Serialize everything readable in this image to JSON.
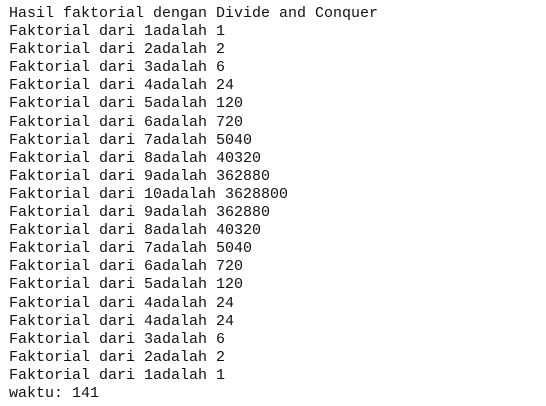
{
  "console": {
    "header": "Hasil faktorial dengan Divide and Conquer",
    "lines": [
      "Faktorial dari 1adalah 1",
      "Faktorial dari 2adalah 2",
      "Faktorial dari 3adalah 6",
      "Faktorial dari 4adalah 24",
      "Faktorial dari 5adalah 120",
      "Faktorial dari 6adalah 720",
      "Faktorial dari 7adalah 5040",
      "Faktorial dari 8adalah 40320",
      "Faktorial dari 9adalah 362880",
      "Faktorial dari 10adalah 3628800",
      "Faktorial dari 9adalah 362880",
      "Faktorial dari 8adalah 40320",
      "Faktorial dari 7adalah 5040",
      "Faktorial dari 6adalah 720",
      "Faktorial dari 5adalah 120",
      "Faktorial dari 4adalah 24",
      "Faktorial dari 4adalah 24",
      "Faktorial dari 3adalah 6",
      "Faktorial dari 2adalah 2",
      "Faktorial dari 1adalah 1"
    ],
    "footer": "waktu: 141"
  }
}
